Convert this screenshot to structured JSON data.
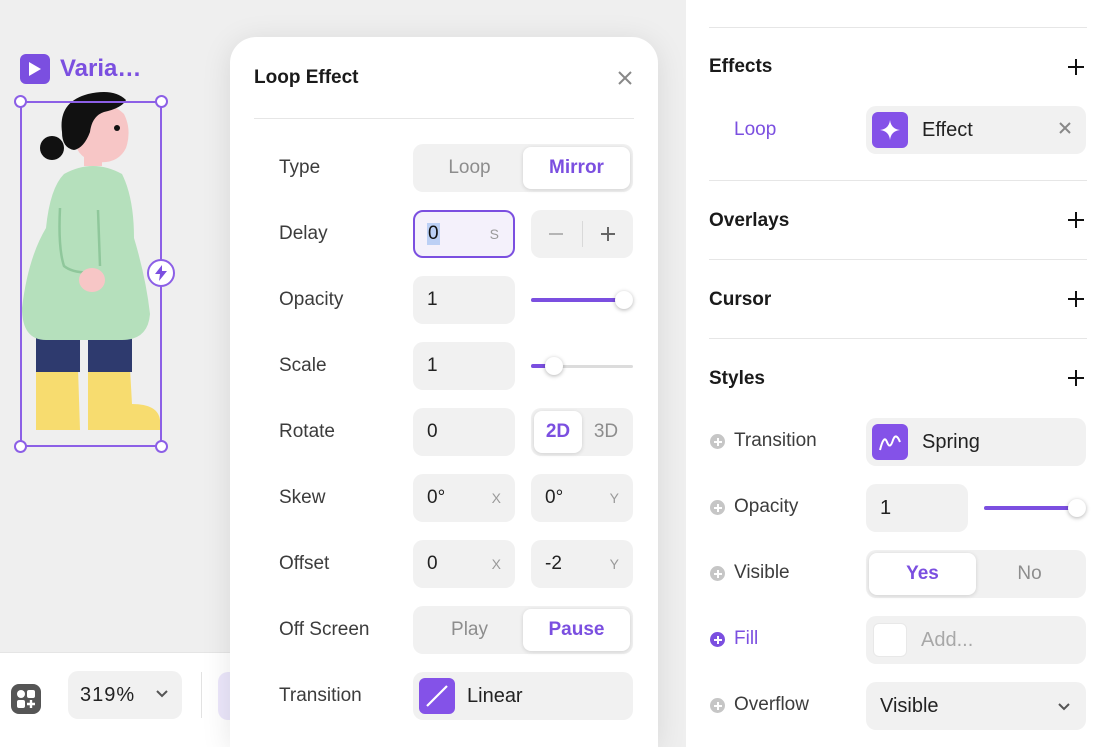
{
  "canvas": {
    "frame_label": "Varia…",
    "zoom_value": "319%"
  },
  "modal": {
    "title": "Loop Effect",
    "type": {
      "label": "Type",
      "options": [
        "Loop",
        "Mirror"
      ],
      "selected": "Mirror"
    },
    "delay": {
      "label": "Delay",
      "value": "0",
      "unit": "S"
    },
    "opacity": {
      "label": "Opacity",
      "value": "1",
      "slider_level": 1.0
    },
    "scale": {
      "label": "Scale",
      "value": "1",
      "slider_level": 0.17
    },
    "rotate": {
      "label": "Rotate",
      "value": "0",
      "modes": [
        "2D",
        "3D"
      ],
      "selected": "2D"
    },
    "skew": {
      "label": "Skew",
      "x_value": "0°",
      "x_axis": "X",
      "y_value": "0°",
      "y_axis": "Y"
    },
    "offset": {
      "label": "Offset",
      "x_value": "0",
      "x_axis": "X",
      "y_value": "-2",
      "y_axis": "Y"
    },
    "off_screen": {
      "label": "Off Screen",
      "options": [
        "Play",
        "Pause"
      ],
      "selected": "Pause"
    },
    "transition": {
      "label": "Transition",
      "value": "Linear"
    }
  },
  "panel": {
    "effects": {
      "heading": "Effects",
      "loop_label": "Loop",
      "effect_value": "Effect"
    },
    "overlays": {
      "heading": "Overlays"
    },
    "cursor": {
      "heading": "Cursor"
    },
    "styles": {
      "heading": "Styles",
      "transition": {
        "label": "Transition",
        "value": "Spring"
      },
      "opacity": {
        "label": "Opacity",
        "value": "1",
        "slider_level": 1.0
      },
      "visible": {
        "label": "Visible",
        "options": [
          "Yes",
          "No"
        ],
        "selected": "Yes"
      },
      "fill": {
        "label": "Fill",
        "placeholder": "Add..."
      },
      "overflow": {
        "label": "Overflow",
        "value": "Visible"
      }
    }
  },
  "colors": {
    "accent": "#7b4fe0",
    "accent_icon": "#8452e8",
    "figure_shirt": "#b5e0bc",
    "figure_pants": "#2e3a6e",
    "figure_boots": "#f7dc6f",
    "figure_skin": "#f7c6c6"
  }
}
